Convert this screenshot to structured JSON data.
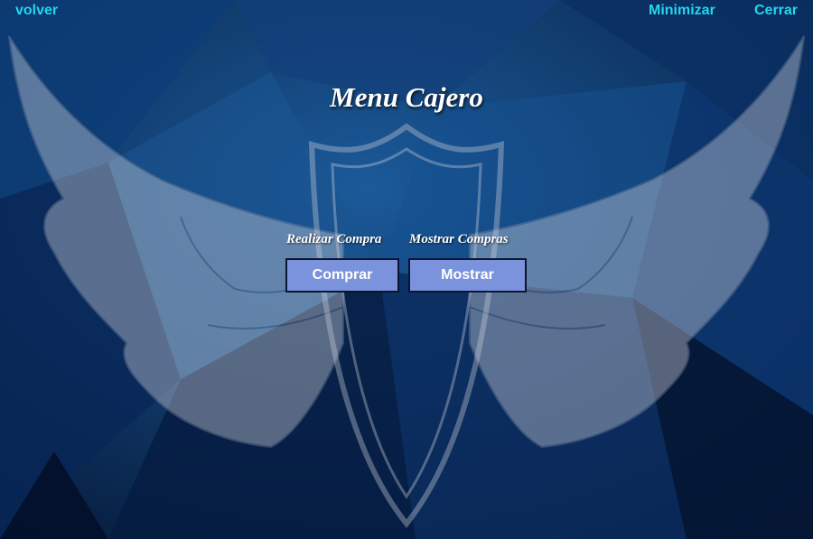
{
  "window": {
    "back_label": "volver",
    "minimize_label": "Minimizar",
    "close_label": "Cerrar"
  },
  "main": {
    "title": "Menu Cajero",
    "purchase_caption": "Realizar Compra",
    "show_caption": "Mostrar Compras",
    "purchase_button": "Comprar",
    "show_button": "Mostrar"
  },
  "colors": {
    "background": "#0b2a55",
    "link": "#22d6f0",
    "button": "#7b93dc",
    "text": "#ffffff"
  },
  "icons": {
    "emblem": "winged-shield-icon"
  }
}
